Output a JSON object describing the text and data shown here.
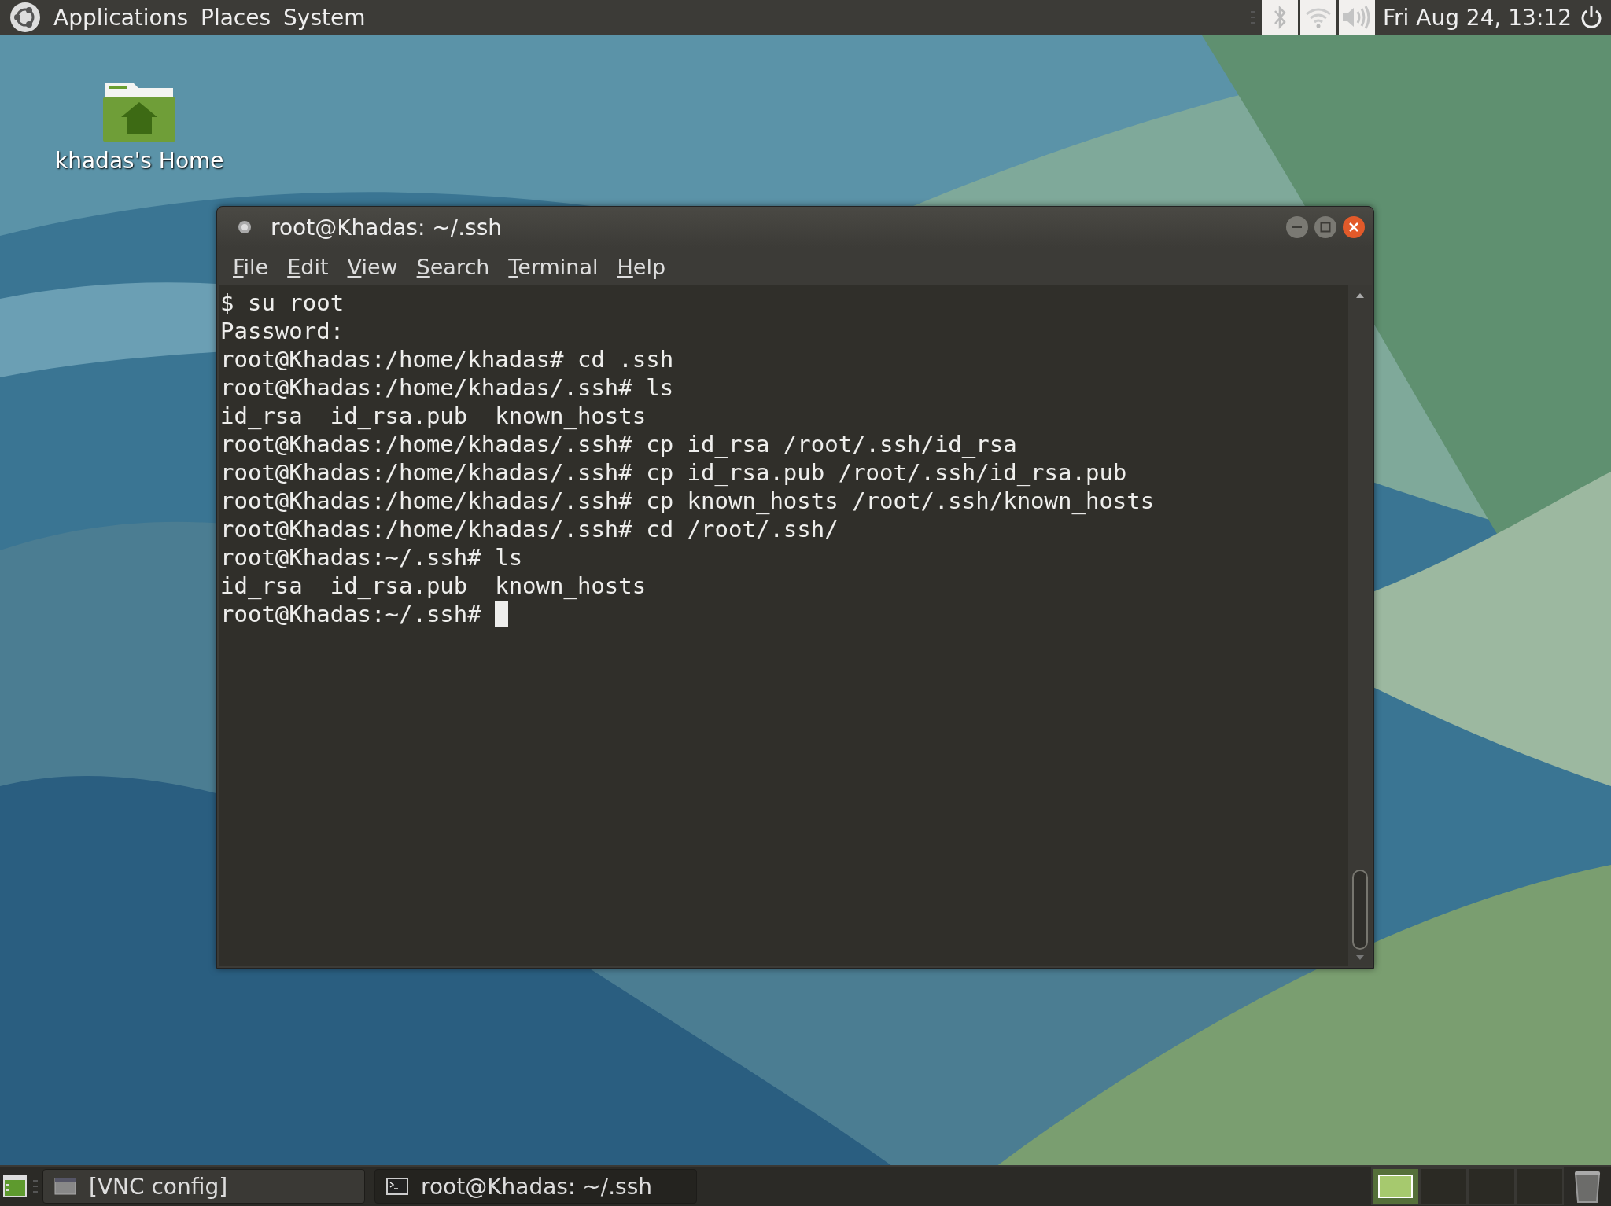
{
  "top_panel": {
    "menus": [
      {
        "label": "Applications"
      },
      {
        "label": "Places"
      },
      {
        "label": "System"
      }
    ],
    "clock": "Fri Aug 24, 13:12"
  },
  "desktop_icons": [
    {
      "label": "khadas's Home"
    }
  ],
  "terminal_window": {
    "title": "root@Khadas: ~/.ssh",
    "menu": [
      {
        "label": "File"
      },
      {
        "label": "Edit"
      },
      {
        "label": "View"
      },
      {
        "label": "Search"
      },
      {
        "label": "Terminal"
      },
      {
        "label": "Help"
      }
    ],
    "lines": [
      "$ su root",
      "Password:",
      "root@Khadas:/home/khadas# cd .ssh",
      "root@Khadas:/home/khadas/.ssh# ls",
      "id_rsa  id_rsa.pub  known_hosts",
      "root@Khadas:/home/khadas/.ssh# cp id_rsa /root/.ssh/id_rsa",
      "root@Khadas:/home/khadas/.ssh# cp id_rsa.pub /root/.ssh/id_rsa.pub",
      "root@Khadas:/home/khadas/.ssh# cp known_hosts /root/.ssh/known_hosts",
      "root@Khadas:/home/khadas/.ssh# cd /root/.ssh/",
      "root@Khadas:~/.ssh# ls",
      "id_rsa  id_rsa.pub  known_hosts",
      "root@Khadas:~/.ssh# "
    ]
  },
  "taskbar": {
    "tasks": [
      {
        "label": "[VNC config]",
        "selected": false
      },
      {
        "label": "root@Khadas: ~/.ssh",
        "selected": true
      }
    ],
    "workspaces": [
      {
        "selected": true
      },
      {
        "selected": false
      },
      {
        "selected": false
      },
      {
        "selected": false
      }
    ]
  }
}
